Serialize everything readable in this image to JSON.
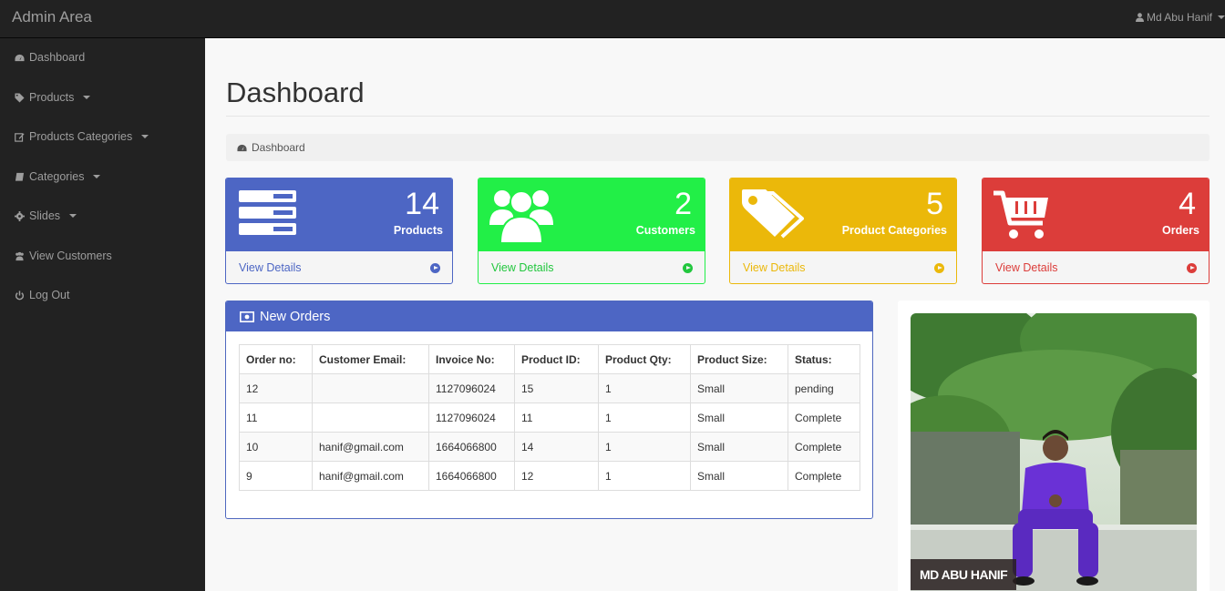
{
  "topbar": {
    "brand": "Admin Area",
    "user_name": "Md Abu Hanif"
  },
  "sidebar": {
    "items": [
      {
        "label": "Dashboard",
        "icon": "dashboard-icon",
        "has_caret": false
      },
      {
        "label": "Products",
        "icon": "tag-icon",
        "has_caret": true
      },
      {
        "label": "Products Categories",
        "icon": "edit-icon",
        "has_caret": true
      },
      {
        "label": "Categories",
        "icon": "book-icon",
        "has_caret": true
      },
      {
        "label": "Slides",
        "icon": "gear-icon",
        "has_caret": true
      },
      {
        "label": "View Customers",
        "icon": "users-icon",
        "has_caret": false
      },
      {
        "label": "Log Out",
        "icon": "power-icon",
        "has_caret": false
      }
    ]
  },
  "page": {
    "title": "Dashboard",
    "breadcrumb": "Dashboard"
  },
  "cards": [
    {
      "count": "14",
      "label": "Products",
      "link": "View Details",
      "color": "#4d66c4",
      "icon": "server-icon"
    },
    {
      "count": "2",
      "label": "Customers",
      "link": "View Details",
      "color": "#22ef47",
      "icon": "users-icon"
    },
    {
      "count": "5",
      "label": "Product Categories",
      "link": "View Details",
      "color": "#ebb80a",
      "icon": "tags-icon"
    },
    {
      "count": "4",
      "label": "Orders",
      "link": "View Details",
      "color": "#dc3d3a",
      "icon": "cart-icon"
    }
  ],
  "orders": {
    "title": "New Orders",
    "columns": [
      "Order no:",
      "Customer Email:",
      "Invoice No:",
      "Product ID:",
      "Product Qty:",
      "Product Size:",
      "Status:"
    ],
    "rows": [
      [
        "12",
        "",
        "1127096024",
        "15",
        "1",
        "Small",
        "pending"
      ],
      [
        "11",
        "",
        "1127096024",
        "11",
        "1",
        "Small",
        "Complete"
      ],
      [
        "10",
        "hanif@gmail.com",
        "1664066800",
        "14",
        "1",
        "Small",
        "Complete"
      ],
      [
        "9",
        "hanif@gmail.com",
        "1664066800",
        "12",
        "1",
        "Small",
        "Complete"
      ]
    ]
  },
  "profile": {
    "caption": "MD ABU HANIF"
  }
}
